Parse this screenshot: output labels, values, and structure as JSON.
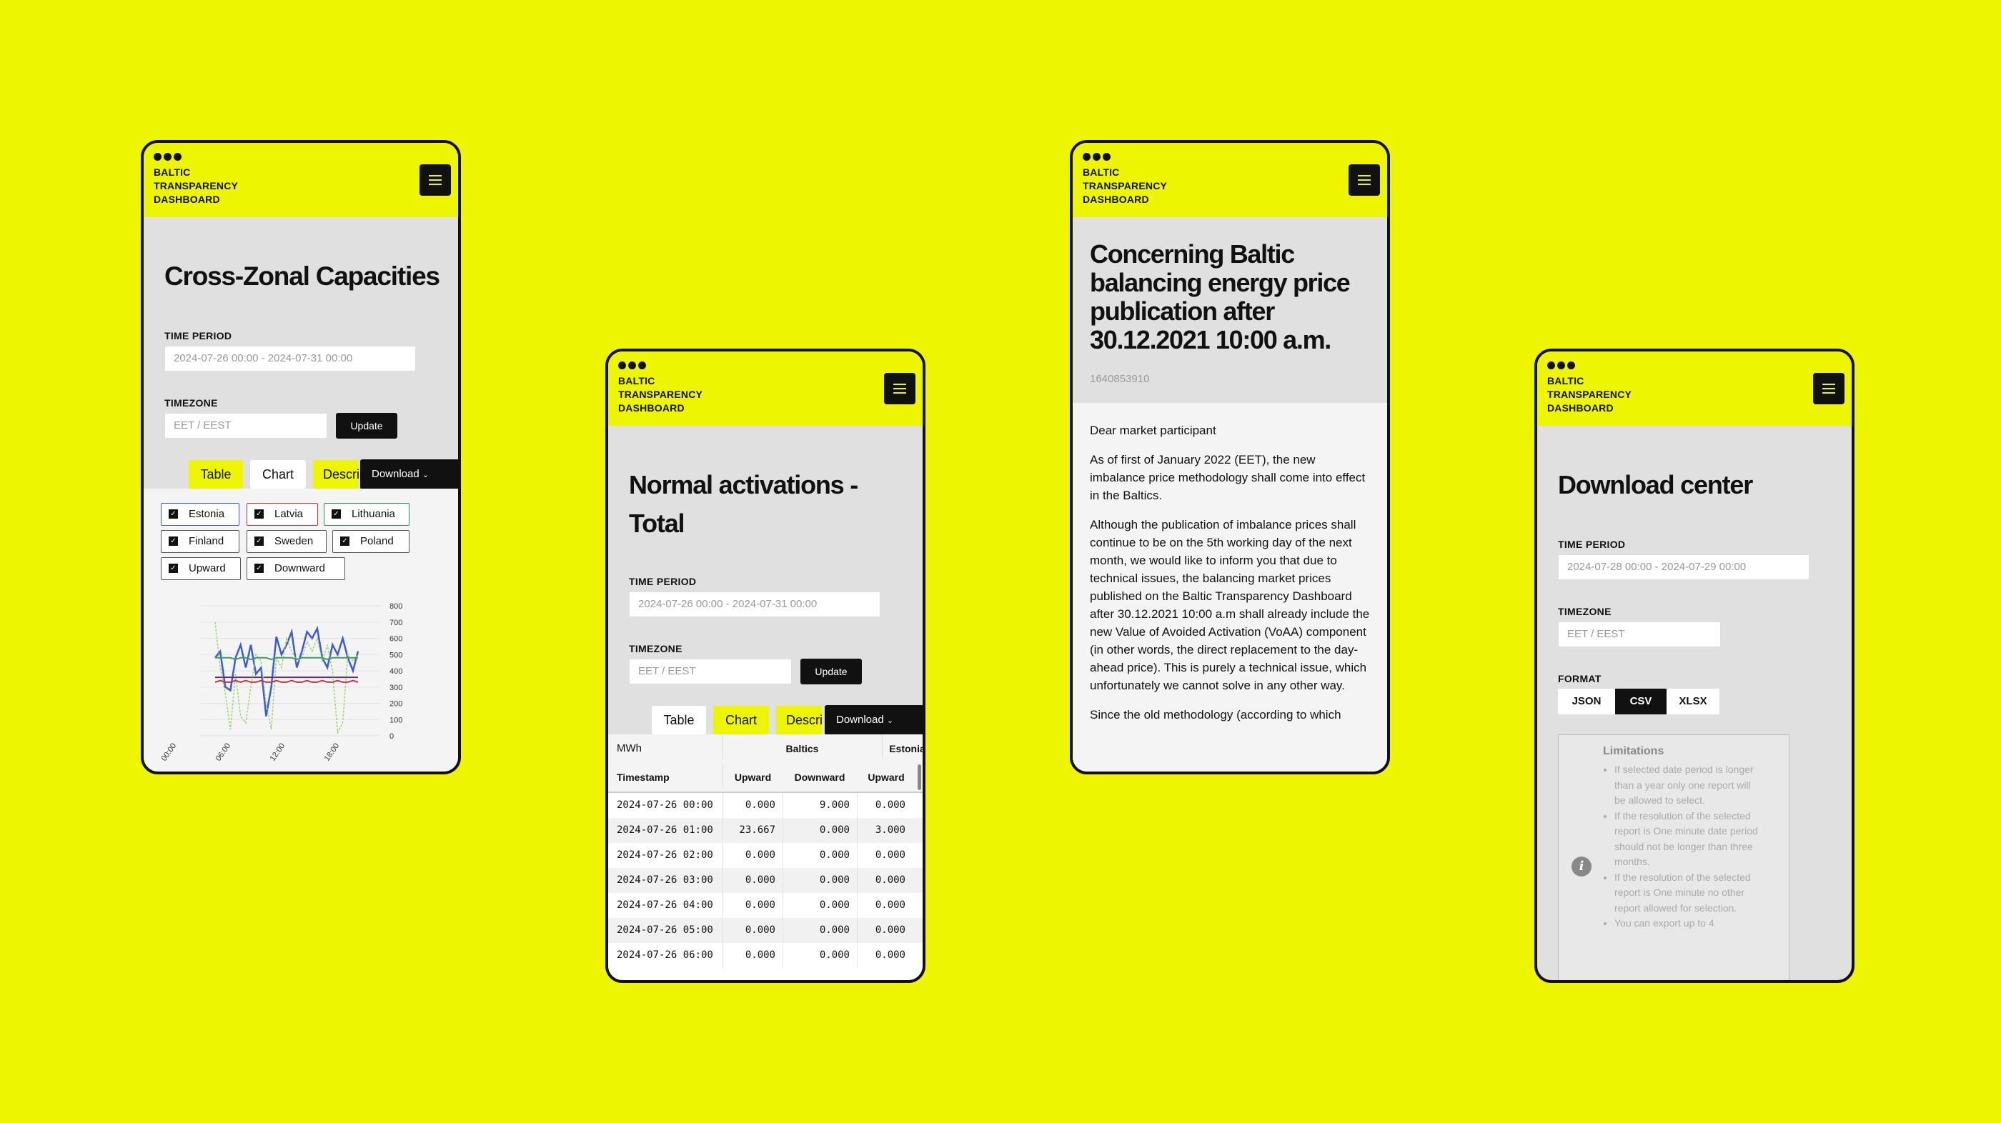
{
  "brand": {
    "lines": [
      "BALTIC",
      "TRANSPARENCY",
      "DASHBOARD"
    ]
  },
  "screen1": {
    "title": "Cross-Zonal Capacities",
    "time_period_label": "TIME PERIOD",
    "time_period_value": "2024-07-26 00:00 - 2024-07-31 00:00",
    "timezone_label": "TIMEZONE",
    "timezone_value": "EET / EEST",
    "update_label": "Update",
    "tabs": [
      "Table",
      "Chart",
      "Description"
    ],
    "download_label": "Download",
    "filters": [
      {
        "label": "Estonia",
        "color": "#3D5BD9"
      },
      {
        "label": "Latvia",
        "color": "#C8323C"
      },
      {
        "label": "Lithuania",
        "color": "#2E8B57"
      },
      {
        "label": "Finland",
        "color": "#555555"
      },
      {
        "label": "Sweden",
        "color": "#555555"
      },
      {
        "label": "Poland",
        "color": "#555555"
      },
      {
        "label": "Upward",
        "color": "#555555"
      },
      {
        "label": "Downward",
        "color": "#555555"
      }
    ]
  },
  "chart_data": {
    "type": "line",
    "y_ticks": [
      800,
      700,
      600,
      500,
      400,
      300,
      200,
      100,
      0
    ],
    "ylim": [
      0,
      800
    ],
    "x_ticks": [
      "00:00",
      "06:00",
      "12:00",
      "18:00"
    ],
    "series": [
      {
        "color": "#3D5BD9",
        "values": [
          480,
          520,
          300,
          280,
          480,
          560,
          420,
          560,
          380,
          420,
          120,
          300,
          610,
          500,
          560,
          640,
          420,
          520,
          640,
          600,
          660,
          480,
          420,
          560,
          500,
          600,
          480,
          400,
          520
        ]
      },
      {
        "color": "#6B2A6B",
        "values": [
          360,
          360,
          360,
          360,
          360,
          360,
          360,
          360,
          360,
          360,
          360,
          360,
          360,
          360,
          360,
          360,
          360,
          360,
          360,
          360,
          360,
          360,
          360,
          360,
          360,
          360,
          360,
          360,
          360
        ]
      },
      {
        "color": "#9BD36B",
        "values": [
          700,
          420,
          260,
          40,
          380,
          120,
          80,
          300,
          500,
          460,
          200,
          40,
          480,
          420,
          600,
          520,
          460,
          480,
          580,
          520,
          600,
          460,
          560,
          400,
          20,
          80,
          500,
          460,
          500
        ]
      },
      {
        "color": "#3D9F5A",
        "values": [
          480,
          480,
          480,
          480,
          470,
          480,
          480,
          470,
          480,
          480,
          480,
          470,
          480,
          480,
          480,
          480,
          470,
          480,
          480,
          480,
          480,
          480,
          470,
          480,
          480,
          480,
          480,
          480,
          480
        ]
      },
      {
        "color": "#C8323C",
        "values": [
          330,
          340,
          330,
          330,
          340,
          330,
          340,
          330,
          330,
          340,
          330,
          330,
          340,
          330,
          330,
          340,
          330,
          330,
          340,
          330,
          330,
          340,
          330,
          330,
          340,
          330,
          330,
          340,
          330
        ]
      }
    ]
  },
  "screen2": {
    "title": "Normal activations - Total",
    "time_period_label": "TIME PERIOD",
    "time_period_value": "2024-07-26 00:00 - 2024-07-31 00:00",
    "timezone_label": "TIMEZONE",
    "timezone_value": "EET / EEST",
    "update_label": "Update",
    "tabs": [
      "Table",
      "Chart",
      "Description"
    ],
    "download_label": "Download",
    "table": {
      "unit": "MWh",
      "group1": "Baltics",
      "group2": "Estonia",
      "col_timestamp": "Timestamp",
      "col_up": "Upward",
      "col_down": "Downward",
      "rows": [
        [
          "2024-07-26 00:00",
          "0.000",
          "9.000",
          "0.000"
        ],
        [
          "2024-07-26 01:00",
          "23.667",
          "0.000",
          "3.000"
        ],
        [
          "2024-07-26 02:00",
          "0.000",
          "0.000",
          "0.000"
        ],
        [
          "2024-07-26 03:00",
          "0.000",
          "0.000",
          "0.000"
        ],
        [
          "2024-07-26 04:00",
          "0.000",
          "0.000",
          "0.000"
        ],
        [
          "2024-07-26 05:00",
          "0.000",
          "0.000",
          "0.000"
        ],
        [
          "2024-07-26 06:00",
          "0.000",
          "0.000",
          "0.000"
        ]
      ]
    }
  },
  "screen3": {
    "title": "Concerning Baltic balancing energy price publication after 30.12.2021 10:00 a.m.",
    "id": "1640853910",
    "paragraphs": [
      "Dear market participant",
      "As of first of January 2022 (EET), the new imbalance price methodology shall come into effect in the Baltics.",
      "Although the publication of imbalance prices shall continue to be on the 5th working day of the next month, we would like to inform you that due to technical issues, the balancing market prices published on the Baltic Transparency Dashboard after 30.12.2021 10:00 a.m shall already include the new Value of Avoided Activation (VoAA) component (in other words, the direct replacement to the day-ahead price). This is purely a technical issue, which unfortunately we cannot solve in any other way.",
      "Since the old methodology (according to which"
    ]
  },
  "screen4": {
    "title": "Download center",
    "time_period_label": "TIME PERIOD",
    "time_period_value": "2024-07-28 00:00 - 2024-07-29 00:00",
    "timezone_label": "TIMEZONE",
    "timezone_value": "EET / EEST",
    "format_label": "FORMAT",
    "formats": [
      "JSON",
      "CSV",
      "XLSX"
    ],
    "selected_format": "CSV",
    "limits_title": "Limitations",
    "limits": [
      "If selected date period is longer than a year only one report will be allowed to select.",
      "If the resolution of the selected report is One minute date period should not be longer than three months.",
      "If the resolution of the selected report is One minute no other report allowed for selection.",
      "You can export up to 4"
    ]
  }
}
